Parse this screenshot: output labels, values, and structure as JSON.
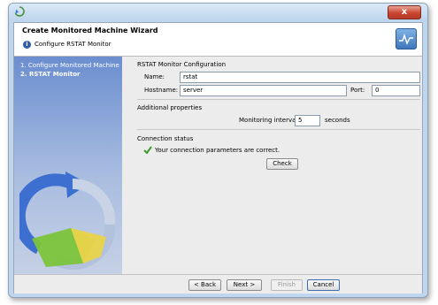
{
  "window": {
    "close_label": "x"
  },
  "wizard": {
    "title": "Create Monitored Machine Wizard",
    "subtitle": "Configure RSTAT Monitor"
  },
  "steps": [
    {
      "label": "1. Configure Monitored Machine",
      "current": false
    },
    {
      "label": "2. RSTAT Monitor",
      "current": true
    }
  ],
  "rstat_config": {
    "heading": "RSTAT Monitor Configuration",
    "name_label": "Name:",
    "name_value": "rstat",
    "hostname_label": "Hostname:",
    "hostname_value": "server",
    "port_label": "Port:",
    "port_value": "0"
  },
  "additional": {
    "heading": "Additional properties",
    "interval_label": "Monitoring interval:",
    "interval_value": "5",
    "interval_unit": "seconds"
  },
  "connection": {
    "heading": "Connection status",
    "status_text": "Your connection parameters are correct.",
    "status_color": "#3a9a2a",
    "check_label": "Check"
  },
  "footer": {
    "back_label": "< Back",
    "next_label": "Next >",
    "finish_label": "Finish",
    "cancel_label": "Cancel"
  },
  "icons": {
    "app": "app-swirl-icon",
    "info": "info-icon",
    "logo": "monitor-wave-icon",
    "status": "checkmark-icon"
  }
}
